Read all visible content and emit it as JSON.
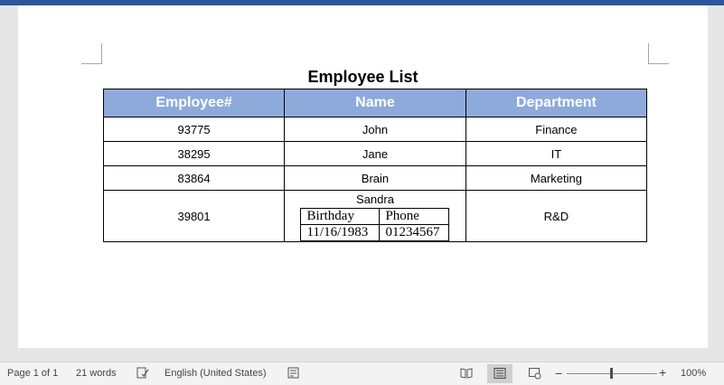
{
  "document": {
    "title": "Employee List",
    "table": {
      "headers": [
        "Employee#",
        "Name",
        "Department"
      ],
      "rows": [
        {
          "id": "93775",
          "name": "John",
          "department": "Finance"
        },
        {
          "id": "38295",
          "name": "Jane",
          "department": "IT"
        },
        {
          "id": "83864",
          "name": "Brain",
          "department": "Marketing"
        },
        {
          "id": "39801",
          "name": "Sandra",
          "department": "R&D",
          "nested": {
            "headers": [
              "Birthday",
              "Phone"
            ],
            "values": [
              "11/16/1983",
              "01234567"
            ]
          }
        }
      ]
    }
  },
  "status_bar": {
    "page": "Page 1 of 1",
    "words": "21 words",
    "language": "English (United States)",
    "zoom": "100%",
    "zoom_minus": "−",
    "zoom_plus": "+"
  },
  "colors": {
    "title_bar": "#2b579a",
    "header_fill": "#8eaadb"
  },
  "icons": [
    "proofing-icon",
    "accessibility-icon",
    "read-mode-icon",
    "print-layout-icon",
    "web-layout-icon"
  ]
}
